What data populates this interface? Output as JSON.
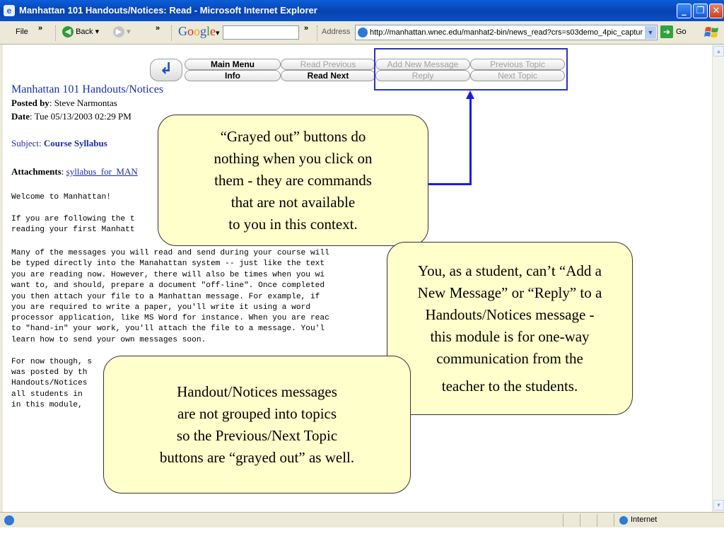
{
  "window": {
    "title": "Manhattan 101 Handouts/Notices: Read - Microsoft Internet Explorer",
    "icon": "ie-page-icon",
    "controls": [
      "minimize",
      "restore",
      "close"
    ]
  },
  "toolbar": {
    "file_menu": "File",
    "chevron": "»",
    "back_label": "Back",
    "google_logo": [
      "G",
      "o",
      "o",
      "g",
      "l",
      "e"
    ],
    "google_dropdown": "▾",
    "address_label": "Address",
    "address_url": "http://manhattan.wnec.edu/manhat2-bin/news_read?crs=s03demo_4pic_captur",
    "go_label": "Go"
  },
  "nav_buttons": {
    "main_menu": "Main Menu",
    "info": "Info",
    "read_previous": "Read Previous",
    "read_next": "Read Next",
    "add_new_message": "Add New Message",
    "reply": "Reply",
    "previous_topic": "Previous Topic",
    "next_topic": "Next Topic"
  },
  "message": {
    "title": "Manhattan 101 Handouts/Notices",
    "posted_by_label": "Posted by",
    "posted_by": "Steve Narmontas",
    "date_label": "Date",
    "date": "Tue 05/13/2003 02:29 PM",
    "subject_label": "Subject:",
    "subject": "Course Syllabus",
    "attachments_label": "Attachments",
    "attachment_link": "syllabus_for_MAN",
    "body_lines": [
      "Welcome to Manhattan!",
      "",
      "If you are following the t",
      "reading your first Manhatt",
      "",
      "Many of the messages you will read and send during your course will",
      "be typed directly into the Manahattan system -- just like the text",
      "you are reading now. However, there will also be times when you wi",
      "want to, and should, prepare a document \"off-line\". Once completed",
      "you then attach your file to a Manhattan message. For example, if",
      "you are required to write a paper, you'll write it using a word",
      "processor application, like MS Word for instance. When you are reac",
      "to \"hand-in\" your work, you'll attach the file to a message. You'l",
      "learn how to send your own messages soon.",
      "",
      "For now though, s",
      "was posted by th",
      "Handouts/Notices",
      "all students in",
      "in this module,"
    ]
  },
  "callouts": {
    "grayed_out": [
      "“Grayed out” buttons do",
      "nothing when you click on",
      "them - they  are commands",
      "that are not available",
      "to you in this context."
    ],
    "student": [
      "You, as a student, can’t “Add a",
      "New Message” or “Reply” to a",
      "Handouts/Notices message -",
      "this module is for one-way",
      "communication from the",
      "teacher to the students."
    ],
    "topics": [
      "Handout/Notices messages",
      "are not  grouped into topics",
      "so the Previous/Next Topic",
      "buttons are “grayed out” as well."
    ]
  },
  "statusbar": {
    "zone": "Internet"
  },
  "colors": {
    "title_bar": "#0842b0",
    "callout_fill": "#ffffcc",
    "highlight_border": "#2b31c9",
    "arrow": "#1c1ce0",
    "link": "#1c2ea8"
  }
}
